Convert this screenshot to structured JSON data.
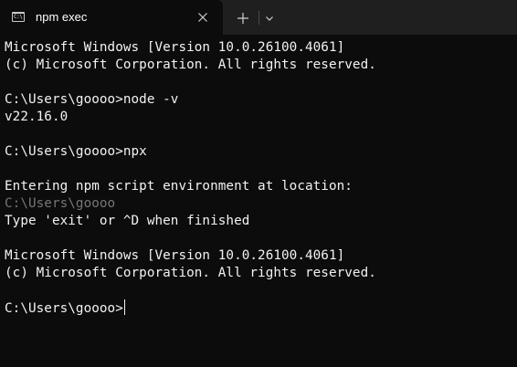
{
  "tab": {
    "title": "npm exec",
    "icon": "terminal-icon",
    "icon_glyph": "C:\\",
    "close_icon": "close-icon"
  },
  "toolbar": {
    "new_tab_icon": "plus-icon",
    "dropdown_icon": "chevron-down-icon"
  },
  "terminal": {
    "lines": [
      {
        "text": "Microsoft Windows [Version 10.0.26100.4061]",
        "style": "bright"
      },
      {
        "text": "(c) Microsoft Corporation. All rights reserved.",
        "style": "bright"
      },
      {
        "text": "",
        "style": "bright"
      },
      {
        "text": "C:\\Users\\goooo>node -v",
        "style": "bright"
      },
      {
        "text": "v22.16.0",
        "style": "bright"
      },
      {
        "text": "",
        "style": "bright"
      },
      {
        "text": "C:\\Users\\goooo>npx",
        "style": "bright"
      },
      {
        "text": "",
        "style": "bright"
      },
      {
        "text": "Entering npm script environment at location:",
        "style": "bright"
      },
      {
        "text": "C:\\Users\\goooo",
        "style": "dim"
      },
      {
        "text": "Type 'exit' or ^D when finished",
        "style": "bright"
      },
      {
        "text": "",
        "style": "bright"
      },
      {
        "text": "Microsoft Windows [Version 10.0.26100.4061]",
        "style": "bright"
      },
      {
        "text": "(c) Microsoft Corporation. All rights reserved.",
        "style": "bright"
      },
      {
        "text": "",
        "style": "bright"
      }
    ],
    "prompt": "C:\\Users\\goooo>"
  },
  "colors": {
    "background": "#0c0c0c",
    "titlebar": "#1f1f1f",
    "text": "#f2f2f2",
    "dim_text": "#767676"
  }
}
